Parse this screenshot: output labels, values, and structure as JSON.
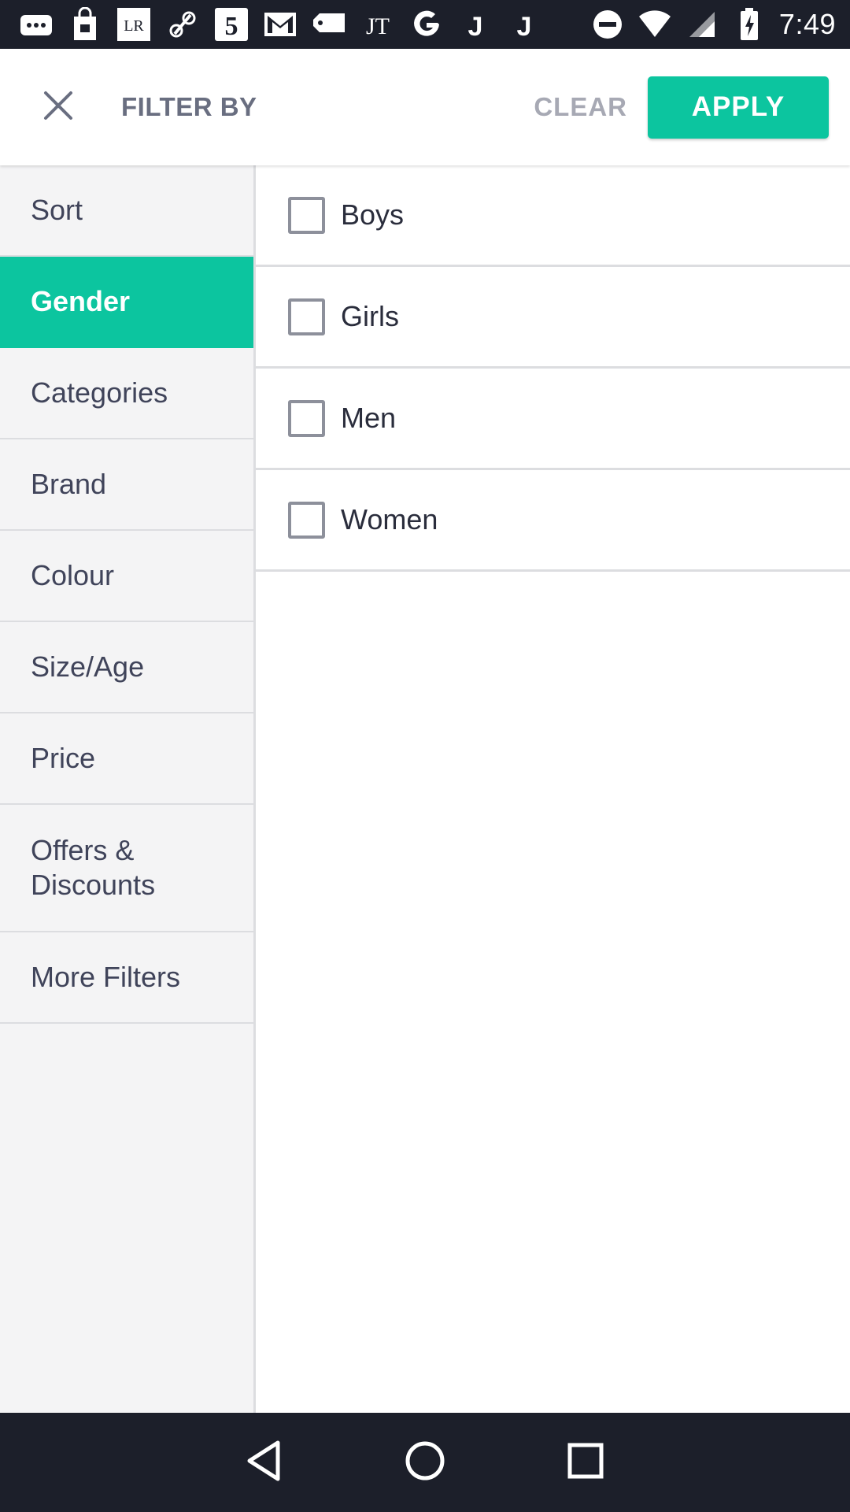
{
  "status_bar": {
    "time": "7:49",
    "notification_icons": [
      "messages-icon",
      "shopping-bag-icon",
      "lr-app-icon",
      "link-icon",
      "five-app-icon",
      "gmail-icon",
      "tag-icon",
      "jt-app-icon",
      "google-icon",
      "j-app-icon",
      "j-app-icon"
    ],
    "lr_text": "LR",
    "five_text": "5",
    "jt_text": "JT",
    "j_text": "J"
  },
  "header": {
    "title": "FILTER BY",
    "clear_label": "CLEAR",
    "apply_label": "APPLY"
  },
  "sidebar": {
    "items": [
      {
        "label": "Sort"
      },
      {
        "label": "Gender",
        "active": true
      },
      {
        "label": "Categories"
      },
      {
        "label": "Brand"
      },
      {
        "label": "Colour"
      },
      {
        "label": "Size/Age"
      },
      {
        "label": "Price"
      },
      {
        "label": "Offers & Discounts"
      },
      {
        "label": "More Filters"
      }
    ]
  },
  "options": [
    {
      "label": "Boys",
      "checked": false
    },
    {
      "label": "Girls",
      "checked": false
    },
    {
      "label": "Men",
      "checked": false
    },
    {
      "label": "Women",
      "checked": false
    }
  ],
  "colors": {
    "accent": "#0cc59f",
    "status_bar": "#1c1f2a"
  }
}
